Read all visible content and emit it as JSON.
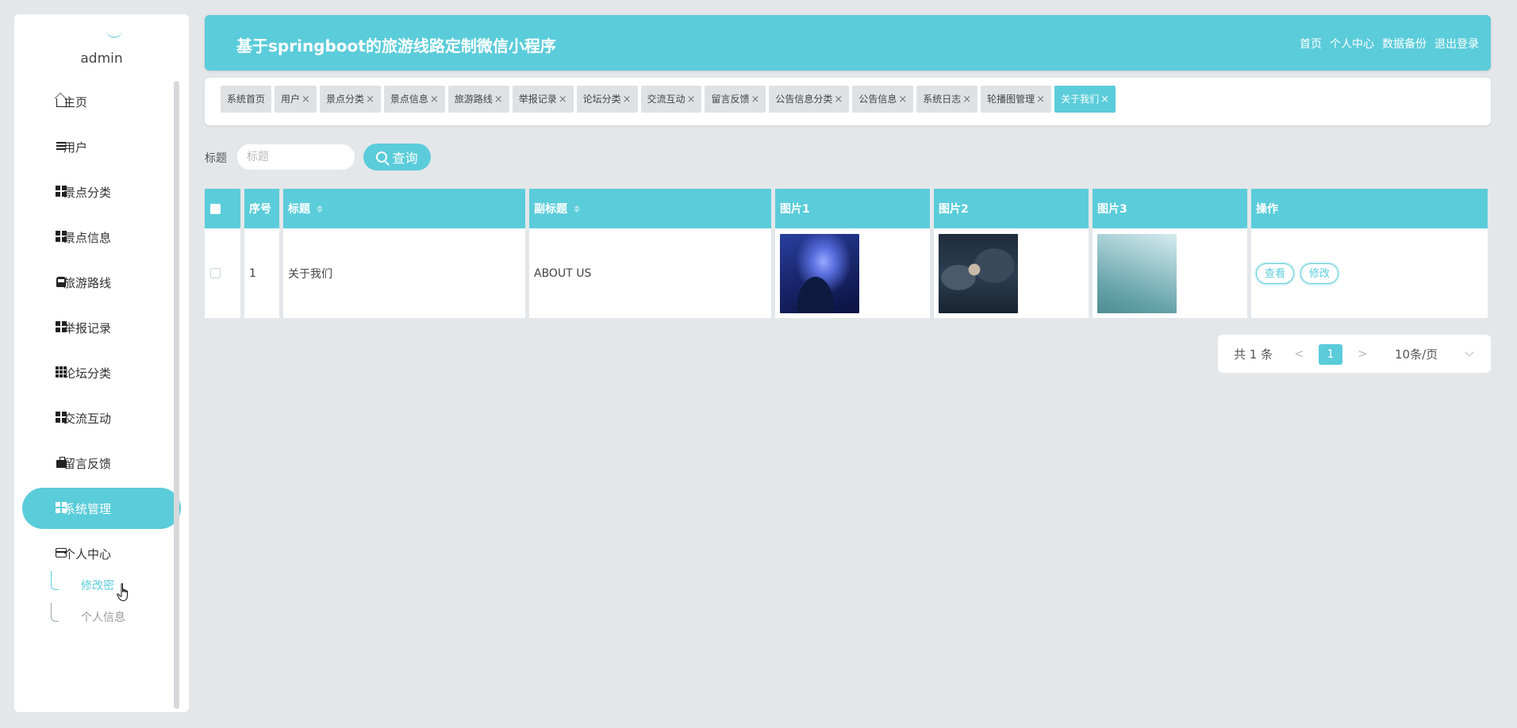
{
  "sidebar": {
    "username": "admin",
    "items": [
      {
        "label": "主页",
        "icon": "home-icon"
      },
      {
        "label": "用户",
        "icon": "list-icon"
      },
      {
        "label": "景点分类",
        "icon": "grid-icon"
      },
      {
        "label": "景点信息",
        "icon": "grid-icon"
      },
      {
        "label": "旅游路线",
        "icon": "bus-icon"
      },
      {
        "label": "举报记录",
        "icon": "grid-icon"
      },
      {
        "label": "论坛分类",
        "icon": "grid-9-icon"
      },
      {
        "label": "交流互动",
        "icon": "grid-icon"
      },
      {
        "label": "留言反馈",
        "icon": "briefcase-icon"
      },
      {
        "label": "系统管理",
        "icon": "grid-icon",
        "active": true
      },
      {
        "label": "个人中心",
        "icon": "card-icon"
      }
    ],
    "subitems": [
      {
        "label": "修改密",
        "current": true
      },
      {
        "label": "个人信息"
      }
    ]
  },
  "header": {
    "title": "基于springboot的旅游线路定制微信小程序",
    "links": [
      "首页",
      "个人中心",
      "数据备份",
      "退出登录"
    ]
  },
  "tags": [
    {
      "label": "系统首页",
      "closable": false
    },
    {
      "label": "用户",
      "closable": true
    },
    {
      "label": "景点分类",
      "closable": true
    },
    {
      "label": "景点信息",
      "closable": true
    },
    {
      "label": "旅游路线",
      "closable": true
    },
    {
      "label": "举报记录",
      "closable": true
    },
    {
      "label": "论坛分类",
      "closable": true
    },
    {
      "label": "交流互动",
      "closable": true
    },
    {
      "label": "留言反馈",
      "closable": true
    },
    {
      "label": "公告信息分类",
      "closable": true
    },
    {
      "label": "公告信息",
      "closable": true
    },
    {
      "label": "系统日志",
      "closable": true
    },
    {
      "label": "轮播图管理",
      "closable": true
    },
    {
      "label": "关于我们",
      "closable": true,
      "active": true
    }
  ],
  "tag_close_glyph": "×",
  "search": {
    "label": "标题",
    "placeholder": "标题",
    "value": "",
    "button": "查询"
  },
  "table": {
    "headers": [
      "序号",
      "标题",
      "副标题",
      "图片1",
      "图片2",
      "图片3",
      "操作"
    ],
    "rows": [
      {
        "index": "1",
        "title": "关于我们",
        "subtitle": "ABOUT US",
        "images": [
          "globe-image",
          "handshake-image",
          "building-image"
        ],
        "actions": [
          "查看",
          "修改"
        ]
      }
    ]
  },
  "pagination": {
    "total": "共 1 条",
    "prev": "<",
    "current_page": "1",
    "next": ">",
    "page_size": "10条/页"
  },
  "colors": {
    "accent": "#5bccda",
    "background": "#e4e7ea",
    "tag_bg": "#dfe2e5"
  }
}
